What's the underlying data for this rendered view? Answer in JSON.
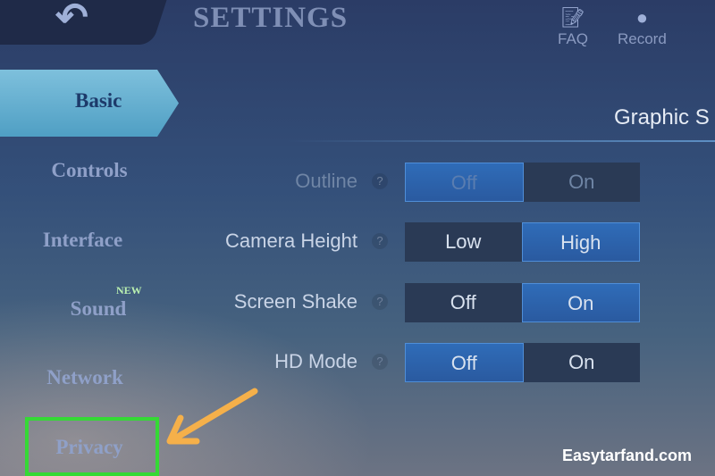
{
  "header": {
    "title": "SETTINGS",
    "back_icon": "back-arrow-icon",
    "faq_label": "FAQ",
    "record_label": "Record"
  },
  "sidebar": {
    "items": [
      {
        "label": "Basic",
        "active": true
      },
      {
        "label": "Controls"
      },
      {
        "label": "Interface"
      },
      {
        "label": "Sound",
        "badge": "NEW"
      },
      {
        "label": "Network"
      },
      {
        "label": "Privacy",
        "highlighted": true
      }
    ]
  },
  "section": {
    "title": "Graphic S"
  },
  "settings": [
    {
      "label": "Outline",
      "options": [
        "Off",
        "On"
      ],
      "selected": "Off",
      "disabled": true
    },
    {
      "label": "Camera Height",
      "options": [
        "Low",
        "High"
      ],
      "selected": "High"
    },
    {
      "label": "Screen Shake",
      "options": [
        "Off",
        "On"
      ],
      "selected": "On"
    },
    {
      "label": "HD Mode",
      "options": [
        "Off",
        "On"
      ],
      "selected": "Off"
    }
  ],
  "watermark": "Easytarfand.com",
  "colors": {
    "highlight": "#35d935",
    "arrow": "#f5b04a",
    "selected": "#2f6cb8"
  }
}
